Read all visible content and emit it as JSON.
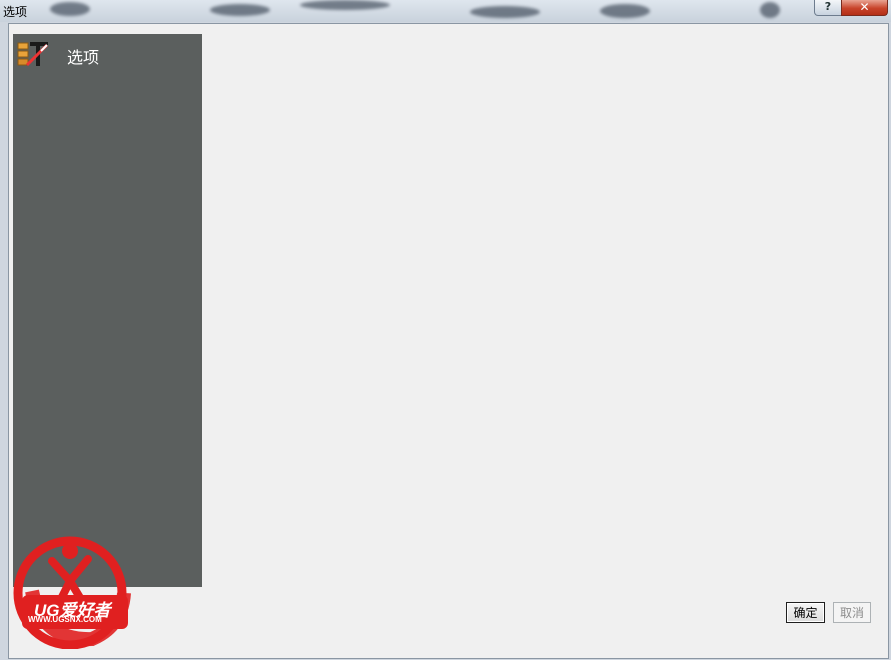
{
  "window": {
    "title": "选项",
    "help_glyph": "?",
    "close_glyph": "✕"
  },
  "sidebar": {
    "items": [
      {
        "label": "选项",
        "icon": "settings-tool-icon"
      }
    ]
  },
  "footer": {
    "ok_label": "确定",
    "cancel_label": "取消"
  },
  "watermark": {
    "brand": "UG爱好者",
    "url": "WWW.UGSNX.COM",
    "color": "#e02020"
  }
}
